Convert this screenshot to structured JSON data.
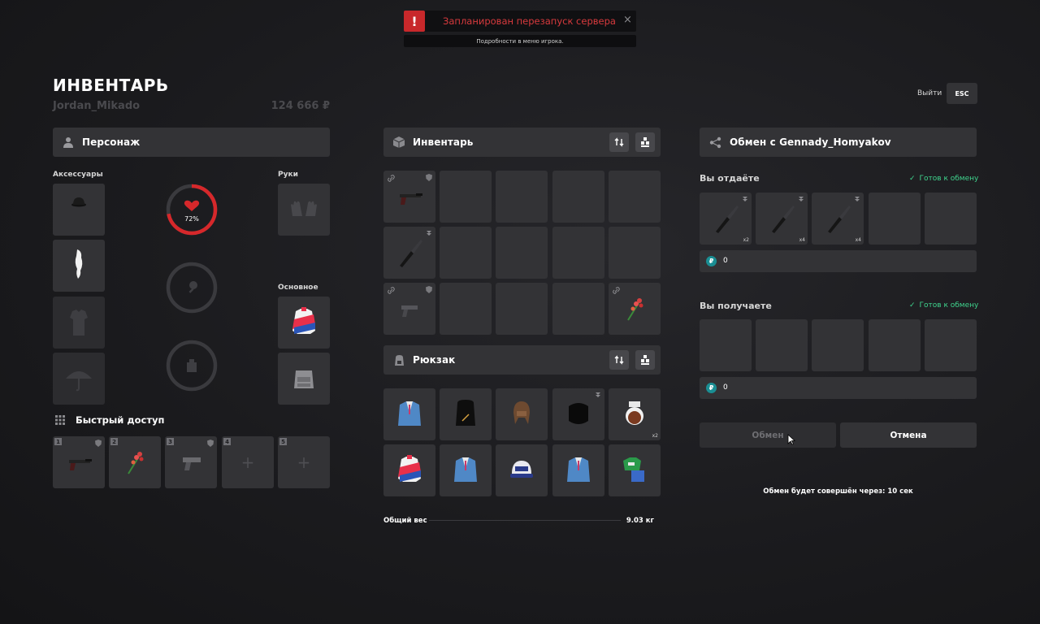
{
  "notification": {
    "title": "Запланирован перезапуск сервера",
    "subtitle": "Подробности в меню игрока.",
    "icon": "exclamation-icon",
    "accent": "#c8282b"
  },
  "header": {
    "title": "ИНВЕНТАРЬ",
    "username": "Jordan_Mikado",
    "balance": "124 666 ₽",
    "exit_label": "Выйти",
    "esc_label": "ESC"
  },
  "character": {
    "title": "Персонаж",
    "accessories_label": "Аксессуары",
    "hands_label": "Руки",
    "main_label": "Основное",
    "health_percent": 72,
    "health_text": "72%"
  },
  "quick_access": {
    "title": "Быстрый доступ",
    "slots": [
      "1",
      "2",
      "3",
      "4",
      "5"
    ]
  },
  "inventory": {
    "title": "Инвентарь"
  },
  "backpack": {
    "title": "Рюкзак",
    "counts": [
      "x2"
    ]
  },
  "weight": {
    "label": "Общий вес",
    "value": "9.03 кг"
  },
  "trade": {
    "title": "Обмен с Gennady_Homyakov",
    "give_label": "Вы отдаёте",
    "receive_label": "Вы получаете",
    "ready_label": "Готов к обмену",
    "give_counts": [
      "x2",
      "x4",
      "x4"
    ],
    "give_money": "0",
    "receive_money": "0",
    "currency_symbol": "₽",
    "trade_button": "Обмен",
    "cancel_button": "Отмена",
    "timer_text": "Обмен будет совершён через: 10 сек"
  },
  "colors": {
    "panel": "#333336",
    "health": "#d6282b",
    "ready": "#3fd58e",
    "currency": "#1a8e93"
  }
}
